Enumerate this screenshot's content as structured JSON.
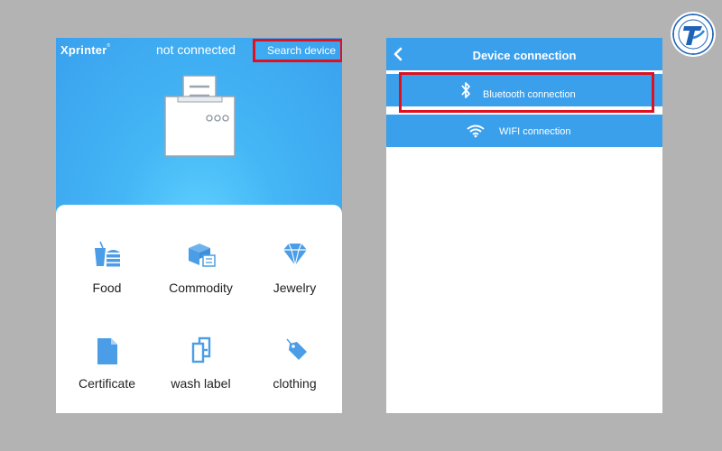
{
  "left_screen": {
    "brand": "Xprinter",
    "brand_mark": "®",
    "status": "not connected",
    "search_button": "Search device",
    "categories": [
      {
        "label": "Food",
        "icon": "food-icon"
      },
      {
        "label": "Commodity",
        "icon": "commodity-icon"
      },
      {
        "label": "Jewelry",
        "icon": "diamond-icon"
      },
      {
        "label": "Certificate",
        "icon": "document-icon"
      },
      {
        "label": "wash label",
        "icon": "wash-label-icon"
      },
      {
        "label": "clothing",
        "icon": "tag-icon"
      }
    ]
  },
  "right_screen": {
    "title": "Device connection",
    "options": [
      {
        "label": "Bluetooth connection",
        "icon": "bluetooth-icon",
        "highlighted": true
      },
      {
        "label": "WIFI connection",
        "icon": "wifi-icon",
        "highlighted": false
      }
    ]
  },
  "colors": {
    "primary_blue": "#3ba0ec",
    "icon_blue": "#4a9de6",
    "highlight_red": "#e0101e",
    "background_gray": "#b3b3b3"
  }
}
